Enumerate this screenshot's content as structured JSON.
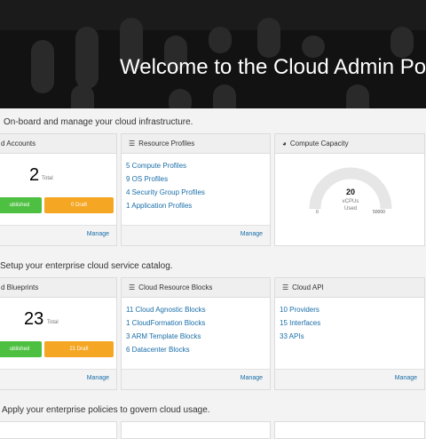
{
  "hero": {
    "title": "Welcome to the Cloud Admin Portal"
  },
  "sections": [
    {
      "text": "On-board and manage your cloud infrastructure."
    },
    {
      "text": "Setup your enterprise cloud service catalog."
    },
    {
      "text": "Apply your enterprise policies to govern cloud usage."
    }
  ],
  "accounts": {
    "title": "d Accounts",
    "count": "2",
    "total_label": "Total",
    "published_label": "ublished",
    "draft_label": "0 Draft",
    "manage": "Manage"
  },
  "resource_profiles": {
    "title": "Resource Profiles",
    "icon": "list-icon",
    "items": [
      "5 Compute Profiles",
      "9 OS Profiles",
      "4 Security Group Profiles",
      "1 Application Profiles"
    ],
    "manage": "Manage"
  },
  "compute_capacity": {
    "title": "Compute Capacity",
    "icon": "gauge-icon",
    "used": "20",
    "unit": "vCPUs",
    "used_label": "Used",
    "min": "0",
    "max": "50000"
  },
  "blueprints": {
    "title": "d Blueprints",
    "count": "23",
    "total_label": "Total",
    "published_label": "ublished",
    "draft_label": "21 Draft",
    "manage": "Manage"
  },
  "cloud_resource_blocks": {
    "title": "Cloud Resource Blocks",
    "icon": "list-icon",
    "items": [
      "11 Cloud Agnostic Blocks",
      "1 CloudFormation Blocks",
      "3 ARM Template Blocks",
      "6 Datacenter Blocks"
    ],
    "manage": "Manage"
  },
  "cloud_api": {
    "title": "Cloud API",
    "icon": "list-icon",
    "items": [
      "10 Providers",
      "15 Interfaces",
      "33 APIs"
    ],
    "manage": "Manage"
  },
  "colors": {
    "link": "#1a6ea8",
    "published": "#4ec041",
    "draft": "#f5a623",
    "hero_bg": "#121212"
  }
}
